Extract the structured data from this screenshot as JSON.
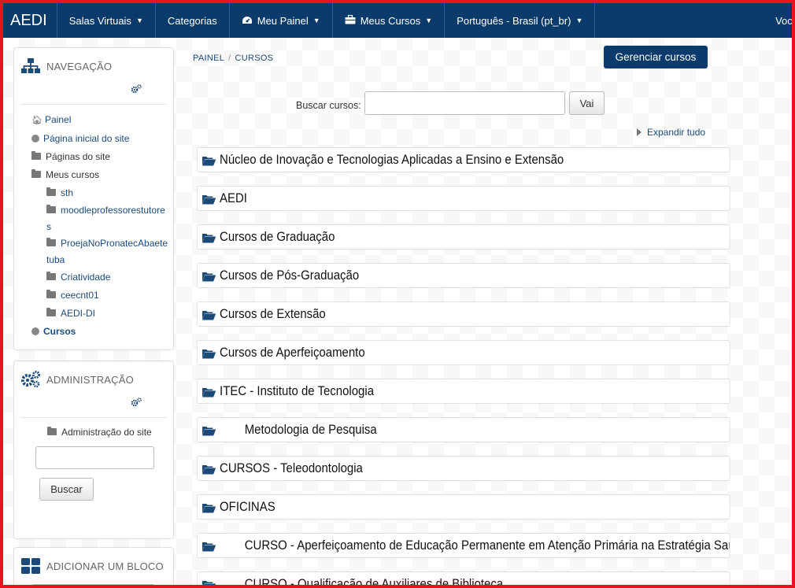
{
  "navbar": {
    "brand": "AEDI",
    "items": [
      {
        "label": "Salas Virtuais",
        "caret": true
      },
      {
        "label": "Categorias",
        "caret": false
      },
      {
        "label": "Meu Painel",
        "caret": true,
        "icon": "dashboard-icon"
      },
      {
        "label": "Meus Cursos",
        "caret": true,
        "icon": "briefcase-icon"
      },
      {
        "label": "Português - Brasil (pt_br)",
        "caret": true
      }
    ],
    "user_text": "Você"
  },
  "navigation_block": {
    "title": "NAVEGAÇÃO",
    "items": [
      {
        "label": "Painel",
        "icon": "home-icon",
        "level": 0
      },
      {
        "label": "Página inicial do site",
        "icon": "bullet-icon",
        "level": 0
      },
      {
        "label": "Páginas do site",
        "icon": "folder-icon",
        "level": 0
      },
      {
        "label": "Meus cursos",
        "icon": "folder-icon",
        "level": 0
      },
      {
        "label": "sth",
        "icon": "folder-icon",
        "level": 1
      },
      {
        "label": "moodleprofessorestutores",
        "icon": "folder-icon",
        "level": 1
      },
      {
        "label": "ProejaNoPronatecAbaetetuba",
        "icon": "folder-icon",
        "level": 1
      },
      {
        "label": "Criatividade",
        "icon": "folder-icon",
        "level": 1
      },
      {
        "label": "ceecnt01",
        "icon": "folder-icon",
        "level": 1
      },
      {
        "label": "AEDI-DI",
        "icon": "folder-icon",
        "level": 1
      },
      {
        "label": "Cursos",
        "icon": "bullet-icon",
        "level": 0
      }
    ]
  },
  "admin_block": {
    "title": "ADMINISTRAÇÃO",
    "link": "Administração do site",
    "search_value": "",
    "search_button": "Buscar"
  },
  "add_block": {
    "title": "ADICIONAR UM BLOCO"
  },
  "breadcrumb": [
    "PAINEL",
    "CURSOS"
  ],
  "manage_button": "Gerenciar cursos",
  "search": {
    "label": "Buscar cursos:",
    "value": "",
    "button": "Vai"
  },
  "expand_all": "Expandir tudo",
  "categories": [
    {
      "label": "Núcleo de Inovação e Tecnologias Aplicadas a Ensino e Extensão",
      "indent": false
    },
    {
      "label": "AEDI",
      "indent": false
    },
    {
      "label": "Cursos de Graduação",
      "indent": false
    },
    {
      "label": "Cursos de Pós-Graduação",
      "indent": false
    },
    {
      "label": "Cursos de Extensão",
      "indent": false
    },
    {
      "label": "Cursos de Aperfeiçoamento",
      "indent": false
    },
    {
      "label": "ITEC - Instituto de Tecnologia",
      "indent": false
    },
    {
      "label": "Metodologia de Pesquisa",
      "indent": true
    },
    {
      "label": "CURSOS - Teleodontologia",
      "indent": false
    },
    {
      "label": "OFICINAS",
      "indent": false
    },
    {
      "label": "CURSO - Aperfeiçoamento de Educação Permanente em Atenção Primária na Estratégia Saúde da Família",
      "indent": true
    },
    {
      "label": "CURSO - Qualificação de Auxiliares de Biblioteca",
      "indent": true
    }
  ]
}
